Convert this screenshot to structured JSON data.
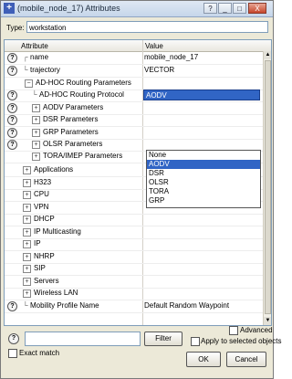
{
  "window": {
    "title": "(mobile_node_17) Attributes",
    "controls": {
      "help": "?",
      "minimize": "_",
      "maximize": "□",
      "close": "X"
    }
  },
  "type_field": {
    "label": "Type:",
    "value": "workstation"
  },
  "grid": {
    "headers": {
      "attribute": "Attribute",
      "value": "Value"
    },
    "rows": [
      {
        "name": "name",
        "value": "mobile_node_17"
      },
      {
        "name": "trajectory",
        "value": "VECTOR"
      },
      {
        "name": "AD-HOC Routing Parameters",
        "value": ""
      },
      {
        "name": "AD-HOC Routing Protocol",
        "value": "AODV"
      },
      {
        "name": "AODV Parameters",
        "value": ""
      },
      {
        "name": "DSR Parameters",
        "value": ""
      },
      {
        "name": "GRP Parameters",
        "value": ""
      },
      {
        "name": "OLSR Parameters",
        "value": ""
      },
      {
        "name": "TORA/IMEP Parameters",
        "value": ""
      },
      {
        "name": "Applications",
        "value": ""
      },
      {
        "name": "H323",
        "value": ""
      },
      {
        "name": "CPU",
        "value": ""
      },
      {
        "name": "VPN",
        "value": ""
      },
      {
        "name": "DHCP",
        "value": ""
      },
      {
        "name": "IP Multicasting",
        "value": ""
      },
      {
        "name": "IP",
        "value": ""
      },
      {
        "name": "NHRP",
        "value": ""
      },
      {
        "name": "SIP",
        "value": ""
      },
      {
        "name": "Servers",
        "value": ""
      },
      {
        "name": "Wireless LAN",
        "value": ""
      },
      {
        "name": "Mobility Profile Name",
        "value": "Default Random Waypoint"
      }
    ],
    "dropdown_options": [
      "None",
      "AODV",
      "DSR",
      "OLSR",
      "TORA",
      "GRP"
    ],
    "dropdown_selected": "AODV",
    "help_glyph": "?",
    "expand_glyph": "+",
    "collapse_glyph": "−"
  },
  "bottom": {
    "advanced_label": "Advanced",
    "filter_label": "Filter",
    "exact_match_label": "Exact match",
    "apply_selected_label": "Apply to selected objects",
    "ok_label": "OK",
    "cancel_label": "Cancel"
  },
  "colors": {
    "selection": "#3165c5",
    "dialog_bg": "#ece9d8",
    "border": "#7f9db9"
  }
}
